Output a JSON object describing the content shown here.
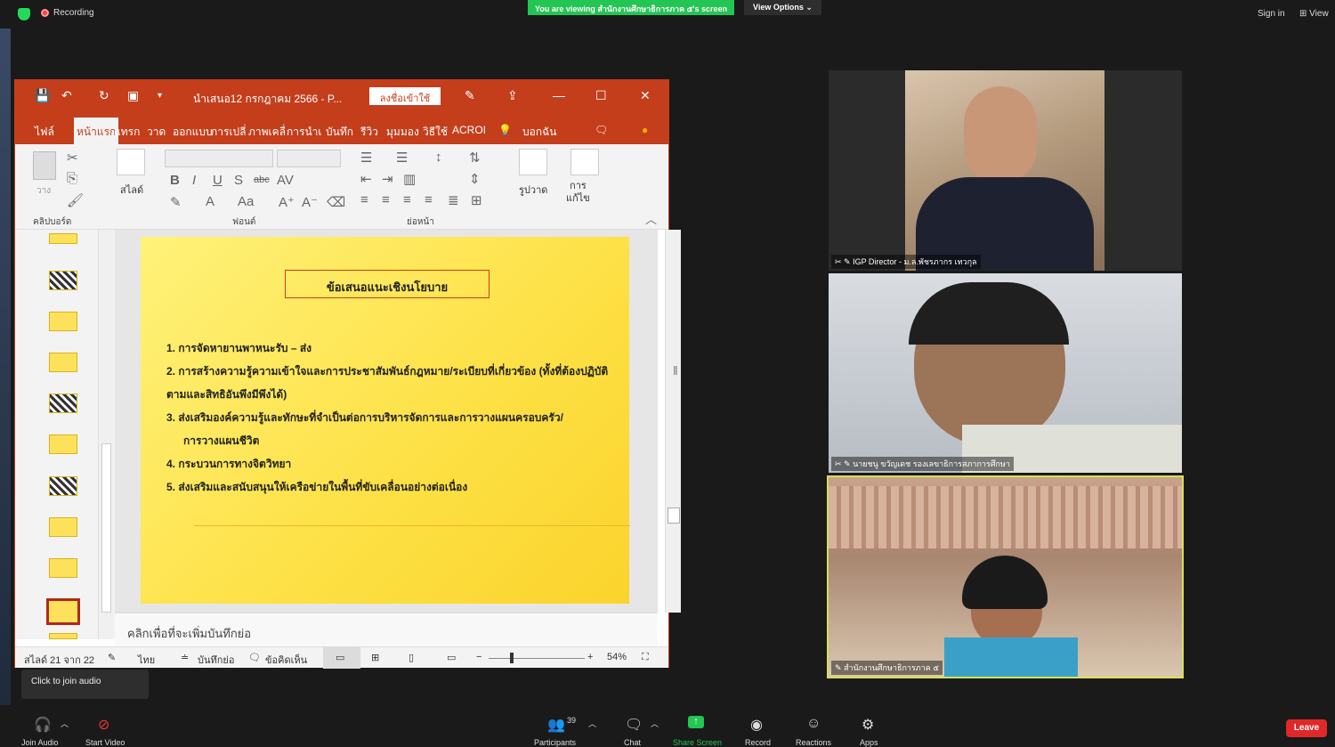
{
  "zoom_top": {
    "recording": "Recording",
    "viewing_banner": "You are viewing สำนักงานศึกษาธิการภาค ๕'s screen",
    "view_options": "View Options",
    "sign_in": "Sign in",
    "view": "View"
  },
  "ppt": {
    "filename": "นำเสนอ12 กรกฎาคม 2566  -  P...",
    "signin_button": "ลงชื่อเข้าใช้",
    "tabs": [
      "ไฟล์",
      "หน้าแรก",
      "แทรก",
      "วาด",
      "ออกแบบ",
      "การเปลี่",
      "ภาพเคลื่",
      "การนำเ",
      "บันทึก",
      "รีวิว",
      "มุมมอง",
      "วิธีใช้",
      "ACROI",
      "บอกฉัน"
    ],
    "ribbon": {
      "slide_label": "สไลด์",
      "shape_label": "รูปวาด",
      "edit_label": "การ\nแก้ไข",
      "paste_label": "วาง",
      "group_clipboard": "คลิปบอร์ด",
      "group_font": "ฟอนต์",
      "group_paragraph": "ย่อหน้า"
    },
    "slide": {
      "title": "ข้อเสนอแนะเชิงนโยบาย",
      "items": [
        "1. การจัดหายานพาหนะรับ  –  ส่ง",
        "2. การสร้างความรู้ความเข้าใจและการประชาสัมพันธ์กฎหมาย/ระเบียบที่เกี่ยวข้อง (ทั้งที่ต้องปฏิบัติ",
        "ตามและสิทธิอันพึงมีพึงได้)",
        "3. ส่งเสริมองค์ความรู้และทักษะที่จำเป็นต่อการบริหารจัดการและการวางแผนครอบครัว/",
        "การวางแผนชีวิต",
        "4. กระบวนการทางจิตวิทยา",
        "5. ส่งเสริมและสนับสนุนให้เครือข่ายในพื้นที่ขับเคลื่อนอย่างต่อเนื่อง"
      ]
    },
    "notes_placeholder": "คลิกเพื่อที่จะเพิ่มบันทึกย่อ",
    "status": {
      "slide_count": "สไลด์ 21 จาก 22",
      "language": "ไทย",
      "notes": "บันทึกย่อ",
      "comments": "ข้อคิดเห็น",
      "zoom": "54%"
    }
  },
  "participants_video": [
    {
      "name": "IGP Director - ม.ล.พัชรภากร เทวกุล"
    },
    {
      "name": "นายชนู ขวัญเดช รองเลขาธิการสภาการศึกษา"
    },
    {
      "name": "สำนักงานศึกษาธิการภาค ๕"
    }
  ],
  "tooltip": "Click to join audio",
  "bottom": {
    "join_audio": "Join Audio",
    "start_video": "Start Video",
    "participants": "Participants",
    "participant_count": "39",
    "chat": "Chat",
    "share_screen": "Share Screen",
    "record": "Record",
    "reactions": "Reactions",
    "apps": "Apps",
    "leave": "Leave"
  }
}
